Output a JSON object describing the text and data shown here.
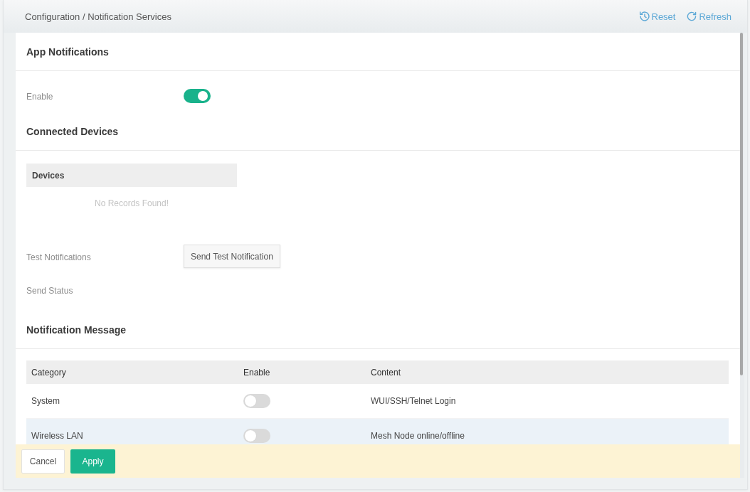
{
  "breadcrumb": "Configuration / Notification Services",
  "header_actions": [
    {
      "label": "Reset",
      "kind": "reset"
    },
    {
      "label": "Refresh",
      "kind": "refresh"
    }
  ],
  "app_notifications": {
    "title": "App Notifications",
    "fields": [
      {
        "label": "Enable",
        "kind": "toggle",
        "on": true
      }
    ]
  },
  "connected_devices": {
    "title": "Connected Devices",
    "table": {
      "columns": [
        "Devices"
      ],
      "empty_text": "No Records Found!"
    },
    "fields": [
      {
        "label": "Test Notifications",
        "kind": "button",
        "button": "Send Test Notification"
      },
      {
        "label": "Send Status",
        "kind": "status"
      }
    ]
  },
  "notification_message": {
    "title": "Notification Message",
    "table": {
      "columns": [
        "Category",
        "Enable",
        "Content"
      ],
      "rows": [
        {
          "category": "System",
          "enabled": false,
          "content": "WUI/SSH/Telnet Login",
          "highlighted": false
        },
        {
          "category": "Wireless LAN",
          "enabled": false,
          "content": "Mesh Node online/offline",
          "highlighted": true
        }
      ]
    }
  },
  "footer": {
    "buttons": [
      {
        "label": "Cancel",
        "kind": "cancel"
      },
      {
        "label": "Apply",
        "kind": "apply"
      }
    ]
  }
}
